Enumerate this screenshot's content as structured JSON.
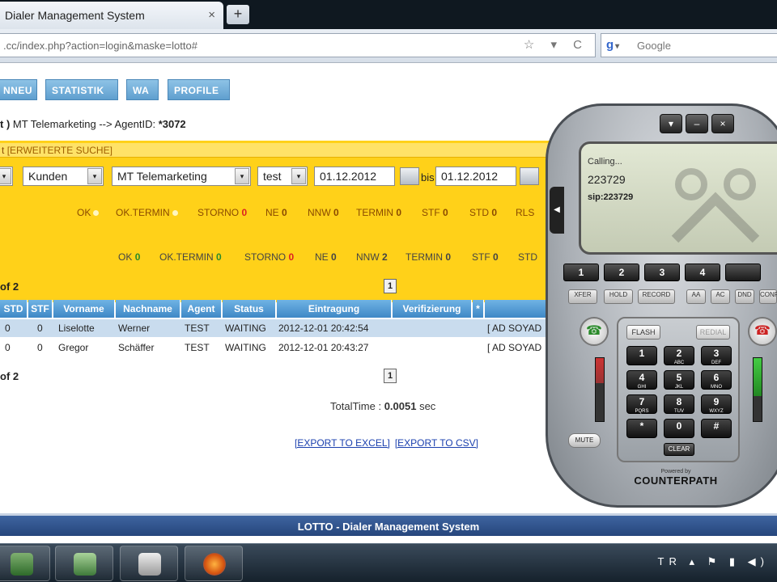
{
  "browser": {
    "tab_title": "Dialer Management System",
    "tab_close": "×",
    "newtab": "+",
    "url": ".cc/index.php?action=login&maske=lotto#",
    "url_icons": "☆ ▾ C",
    "search_placeholder": "Google"
  },
  "nav": {
    "items": [
      "NNEU",
      "STATISTIK",
      "WA",
      "PROFILE"
    ]
  },
  "crumb": {
    "prefix": "t )",
    "text": " MT Telemarketing --> AgentID: ",
    "agent_id": "*3072"
  },
  "search": {
    "extended_label": "[ERWEITERTE SUCHE]",
    "filters": {
      "kunden": "Kunden",
      "company": "MT Telemarketing",
      "user": "test",
      "date_from": "01.12.2012",
      "bis": "bis",
      "date_to": "01.12.2012"
    }
  },
  "stats_yellow": {
    "ok": "OK",
    "ok_termin": "OK.TERMIN",
    "storno": "STORNO",
    "storno_val": "0",
    "ne": "NE",
    "ne_val": "0",
    "nnw": "NNW",
    "nnw_val": "0",
    "termin": "TERMIN",
    "termin_val": "0",
    "stf": "STF",
    "stf_val": "0",
    "std": "STD",
    "std_val": "0",
    "rls": "RLS"
  },
  "stats_white": {
    "ok": "OK",
    "ok_val": "0",
    "ok_termin": "OK.TERMIN",
    "ok_termin_val": "0",
    "storno": "STORNO",
    "storno_val": "0",
    "ne": "NE",
    "ne_val": "0",
    "nnw": "NNW",
    "nnw_val": "2",
    "termin": "TERMIN",
    "termin_val": "0",
    "stf": "STF",
    "stf_val": "0",
    "std": "STD"
  },
  "pager": {
    "top_text": "of 2",
    "bottom_text": "of 2",
    "page": "1"
  },
  "table": {
    "headers": [
      "STD",
      "STF",
      "Vorname",
      "Nachname",
      "Agent",
      "Status",
      "Eintragung",
      "Verifizierung",
      "*"
    ],
    "rows": [
      {
        "std": "0",
        "stf": "0",
        "vorname": "Liselotte",
        "nachname": "Werner",
        "agent": "TEST",
        "status": "WAITING",
        "eintragung": "2012-12-01 20:42:54",
        "action": "[ AD SOYAD"
      },
      {
        "std": "0",
        "stf": "0",
        "vorname": "Gregor",
        "nachname": "Schäffer",
        "agent": "TEST",
        "status": "WAITING",
        "eintragung": "2012-12-01 20:43:27",
        "action": "[ AD SOYAD"
      }
    ]
  },
  "totaltime": {
    "label": "TotalTime : ",
    "value": "0.0051",
    "unit": " sec"
  },
  "exports": {
    "excel": "[EXPORT TO EXCEL]",
    "csv": "[EXPORT TO CSV]"
  },
  "footer": "LOTTO - Dialer Management System",
  "softphone": {
    "status": "Calling...",
    "number": "223729",
    "sip": "sip:223729",
    "lines": [
      "1",
      "2",
      "3",
      "4"
    ],
    "small_keys": [
      "XFER",
      "HOLD",
      "RECORD",
      "AA",
      "AC",
      "DND",
      "CONF"
    ],
    "flash": "FLASH",
    "redial": "REDIAL",
    "keys": [
      {
        "d": "1",
        "s": ""
      },
      {
        "d": "2",
        "s": "ABC"
      },
      {
        "d": "3",
        "s": "DEF"
      },
      {
        "d": "4",
        "s": "GHI"
      },
      {
        "d": "5",
        "s": "JKL"
      },
      {
        "d": "6",
        "s": "MNO"
      },
      {
        "d": "7",
        "s": "PQRS"
      },
      {
        "d": "8",
        "s": "TUV"
      },
      {
        "d": "9",
        "s": "WXYZ"
      },
      {
        "d": "*",
        "s": ""
      },
      {
        "d": "0",
        "s": ""
      },
      {
        "d": "#",
        "s": ""
      }
    ],
    "clear": "CLEAR",
    "mute": "MUTE",
    "powered_by": "Powered by",
    "brand": "COUNTERPATH",
    "top_buttons": [
      "▾",
      "–",
      "×"
    ],
    "side_arrow": "◀"
  },
  "taskbar": {
    "lang": "TR",
    "tray_icons": "▴ ⚑ ▮ ◀)"
  },
  "colors": {
    "accent_yellow": "#ffd119",
    "header_blue": "#3f88c6",
    "footer_blue": "#26467c"
  }
}
